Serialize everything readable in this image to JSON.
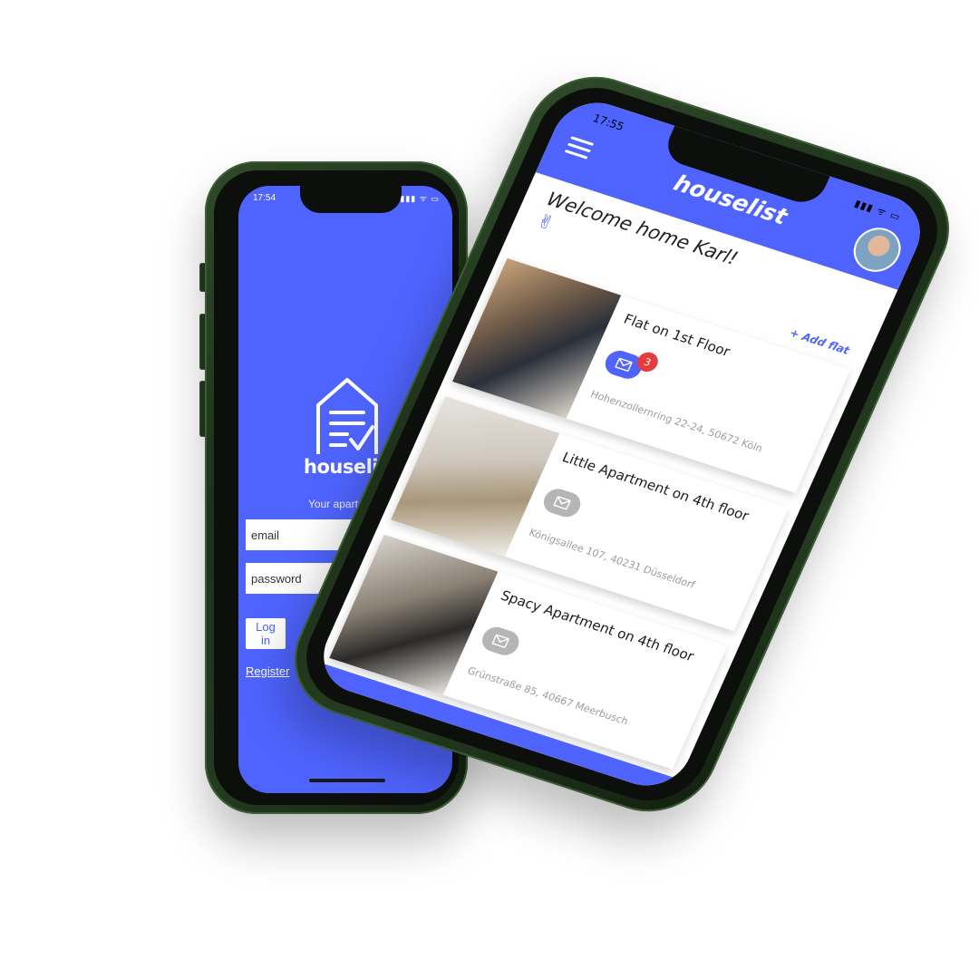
{
  "colors": {
    "brand_blue": "#4f64ff",
    "phone_green": "#243c20",
    "badge_red": "#e53b3b",
    "mail_grey": "#b5b5b5"
  },
  "login_screen": {
    "status_time": "17:54",
    "status_icons": "▮▮▮ ᯤ ▭",
    "logo_text": "houselist",
    "tagline": "Your apartments in one place.",
    "email_placeholder": "email",
    "password_placeholder": "password",
    "login_label": "Log in",
    "register_label": "Register"
  },
  "home_screen": {
    "status_time": "17:55",
    "status_icons": "▮▮▮ ᯤ ▭",
    "app_title": "houselist",
    "welcome_text": "Welcome home Karl!",
    "welcome_emoji": "✌",
    "add_flat_label": "+ Add flat",
    "flats": [
      {
        "name": "Flat on 1st Floor",
        "address": "Hohenzollernring 22-24, 50672 Köln",
        "messages": "3",
        "has_messages": true
      },
      {
        "name": "Little Apartment on 4th floor",
        "address": "Königsallee 107, 40231 Düsseldorf",
        "messages": "",
        "has_messages": false
      },
      {
        "name": "Spacy Apartment on 4th floor",
        "address": "Grünstraße 85, 40667 Meerbusch",
        "messages": "",
        "has_messages": false
      }
    ]
  }
}
